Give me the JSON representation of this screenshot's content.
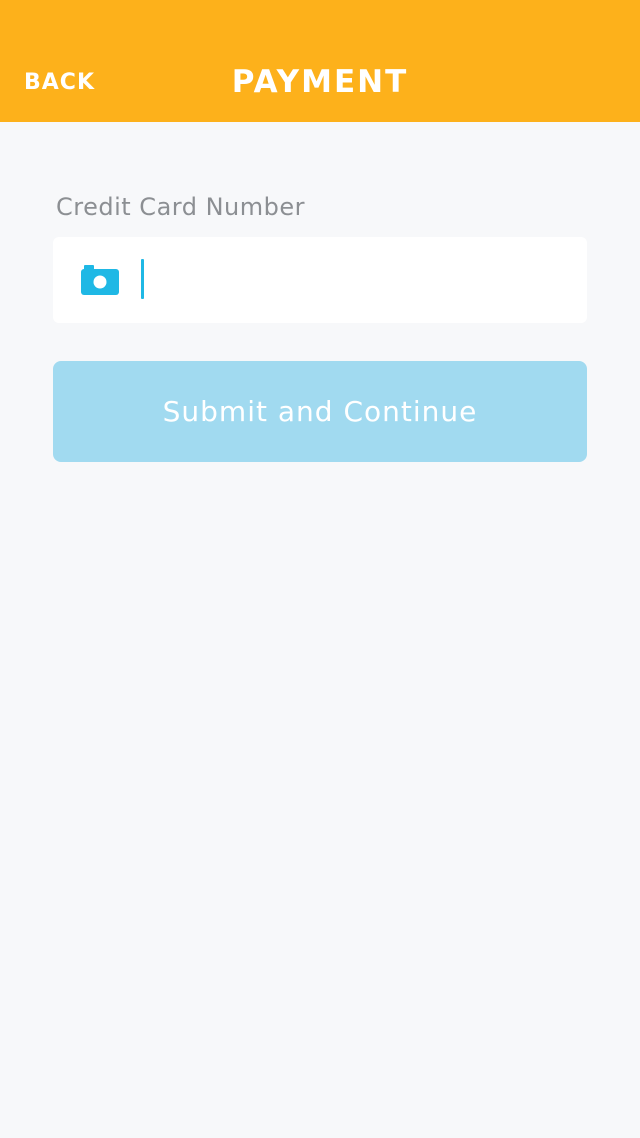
{
  "header": {
    "back_label": "BACK",
    "title": "PAYMENT",
    "background_color": "#fdb11b"
  },
  "form": {
    "card_number_label": "Credit Card Number",
    "card_number_value": "",
    "scan_icon": "camera-icon",
    "submit_label": "Submit and Continue",
    "submit_color": "#a1daf0",
    "accent_color": "#1fb8e5"
  }
}
